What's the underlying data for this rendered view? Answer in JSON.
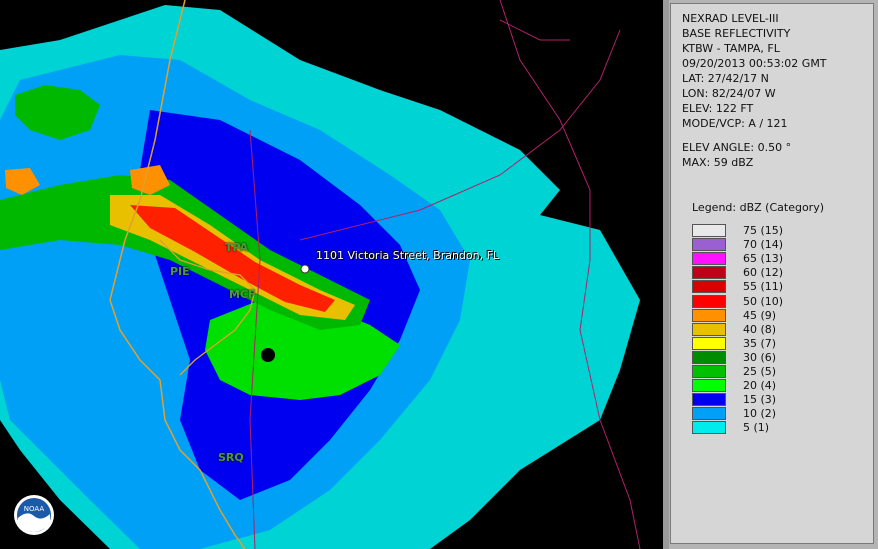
{
  "map": {
    "location_label": "1101 Victoria Street, Brandon, FL",
    "airports": [
      "TPA",
      "PIE",
      "MCF",
      "SRQ"
    ],
    "logo_text": "NOAA"
  },
  "info": {
    "product": "NEXRAD LEVEL-III",
    "type": "BASE REFLECTIVITY",
    "station": "KTBW - TAMPA, FL",
    "datetime": "09/20/2013 00:53:02 GMT",
    "lat": "LAT: 27/42/17 N",
    "lon": "LON: 82/24/07 W",
    "elev": "ELEV: 122 FT",
    "mode": "MODE/VCP: A / 121",
    "elev_angle": "ELEV ANGLE: 0.50 °",
    "max": "MAX: 59 dBZ"
  },
  "legend": {
    "title": "Legend: dBZ (Category)",
    "items": [
      {
        "label": "75  (15)",
        "color": "#e8e8e8"
      },
      {
        "label": "70  (14)",
        "color": "#9a5fd0"
      },
      {
        "label": "65  (13)",
        "color": "#ff10ff"
      },
      {
        "label": "60  (12)",
        "color": "#c00018"
      },
      {
        "label": "55  (11)",
        "color": "#d80000"
      },
      {
        "label": "50  (10)",
        "color": "#ff0000"
      },
      {
        "label": "45  (9)",
        "color": "#ff9000"
      },
      {
        "label": "40  (8)",
        "color": "#e8c000"
      },
      {
        "label": "35  (7)",
        "color": "#ffff00"
      },
      {
        "label": "30  (6)",
        "color": "#008c00"
      },
      {
        "label": "25  (5)",
        "color": "#00c000"
      },
      {
        "label": "20  (4)",
        "color": "#00ff00"
      },
      {
        "label": "15  (3)",
        "color": "#0000f0"
      },
      {
        "label": "10  (2)",
        "color": "#00a0f6"
      },
      {
        "label": "5  (1)",
        "color": "#00ecec"
      }
    ]
  }
}
